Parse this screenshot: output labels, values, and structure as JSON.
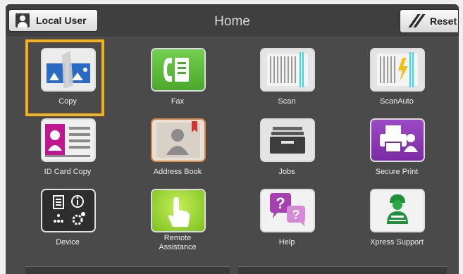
{
  "header": {
    "user_label": "Local User",
    "title": "Home",
    "reset_label": "Reset"
  },
  "apps": [
    {
      "id": "copy",
      "label": "Copy",
      "icon": "copy-icon"
    },
    {
      "id": "fax",
      "label": "Fax",
      "icon": "fax-icon"
    },
    {
      "id": "scan",
      "label": "Scan",
      "icon": "scan-icon"
    },
    {
      "id": "scanauto",
      "label": "ScanAuto",
      "icon": "scanauto-icon"
    },
    {
      "id": "idcard",
      "label": "ID Card Copy",
      "icon": "id-card-icon"
    },
    {
      "id": "addressbook",
      "label": "Address Book",
      "icon": "address-book-icon"
    },
    {
      "id": "jobs",
      "label": "Jobs",
      "icon": "jobs-icon"
    },
    {
      "id": "secureprint",
      "label": "Secure Print",
      "icon": "secure-print-icon"
    },
    {
      "id": "device",
      "label": "Device",
      "icon": "device-icon"
    },
    {
      "id": "remote",
      "label": "Remote\nAssistance",
      "icon": "remote-assistance-icon"
    },
    {
      "id": "help",
      "label": "Help",
      "icon": "help-icon"
    },
    {
      "id": "xpress",
      "label": "Xpress Support",
      "icon": "xpress-support-icon"
    }
  ],
  "selected_app": "copy",
  "colors": {
    "screen_bg": "#4a4a4a",
    "selection": "#f2b21b",
    "fax_green": "#5bbf3a",
    "id_magenta": "#c0168f",
    "secure_purple": "#8b33b5",
    "help_purple": "#a63fb0"
  }
}
